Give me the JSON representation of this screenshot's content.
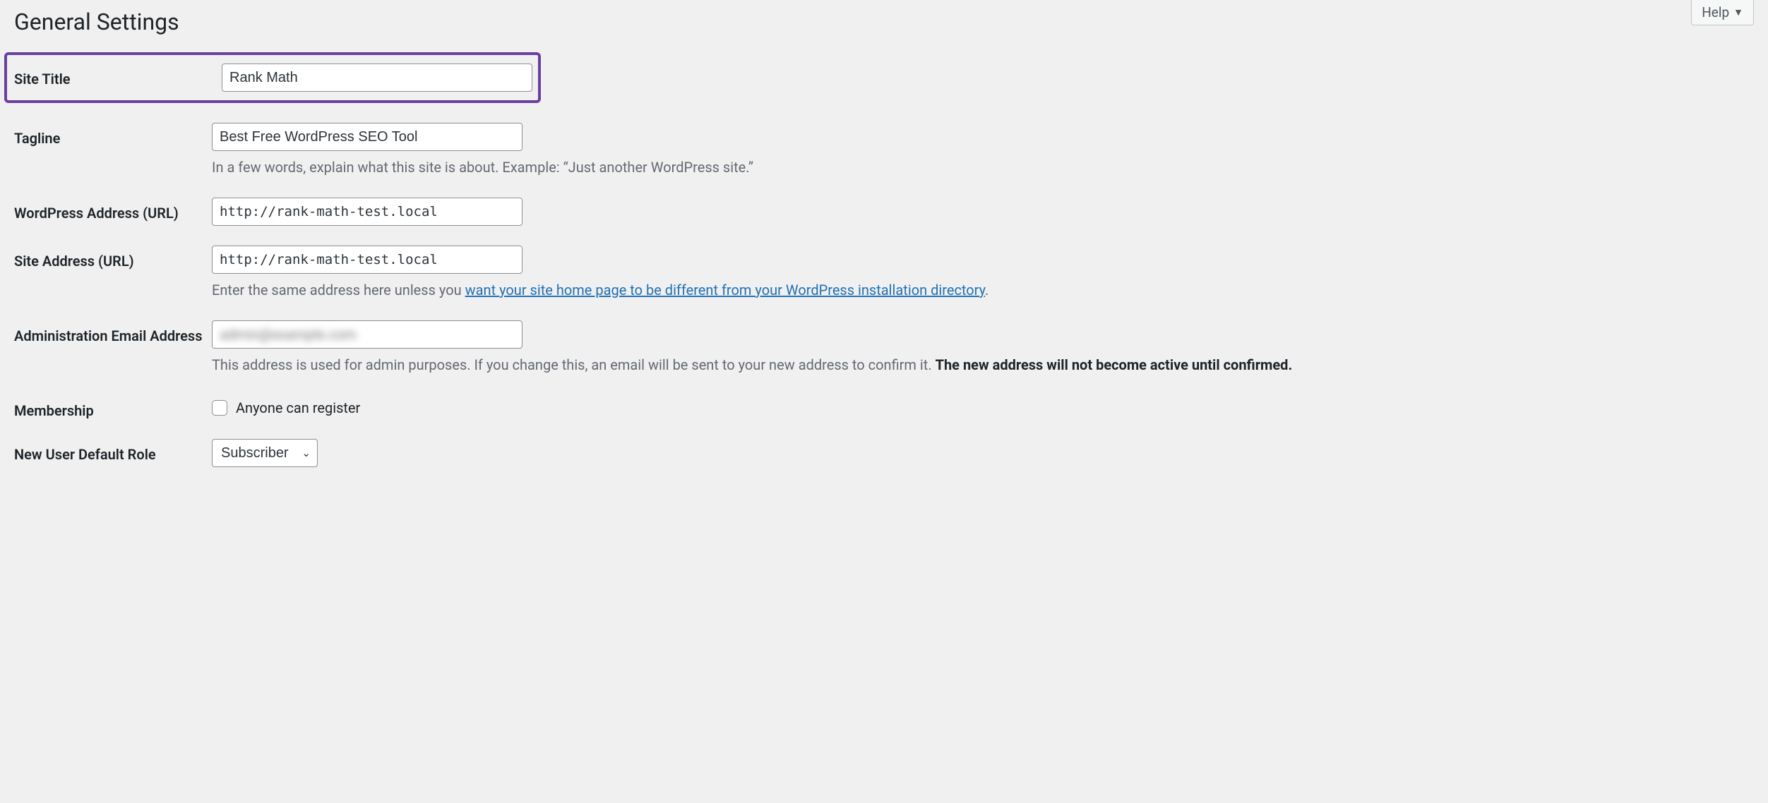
{
  "help": {
    "label": "Help"
  },
  "page": {
    "title": "General Settings"
  },
  "fields": {
    "site_title": {
      "label": "Site Title",
      "value": "Rank Math"
    },
    "tagline": {
      "label": "Tagline",
      "value": "Best Free WordPress SEO Tool",
      "desc": "In a few words, explain what this site is about. Example: “Just another WordPress site.”"
    },
    "wp_address": {
      "label": "WordPress Address (URL)",
      "value": "http://rank-math-test.local"
    },
    "site_address": {
      "label": "Site Address (URL)",
      "value": "http://rank-math-test.local",
      "desc_pre": "Enter the same address here unless you ",
      "desc_link": "want your site home page to be different from your WordPress installation directory",
      "desc_post": "."
    },
    "admin_email": {
      "label": "Administration Email Address",
      "value": "admin@example.com",
      "desc_plain": "This address is used for admin purposes. If you change this, an email will be sent to your new address to confirm it. ",
      "desc_strong": "The new address will not become active until confirmed."
    },
    "membership": {
      "label": "Membership",
      "checkbox_label": "Anyone can register",
      "checked": false
    },
    "default_role": {
      "label": "New User Default Role",
      "selected": "Subscriber"
    }
  }
}
